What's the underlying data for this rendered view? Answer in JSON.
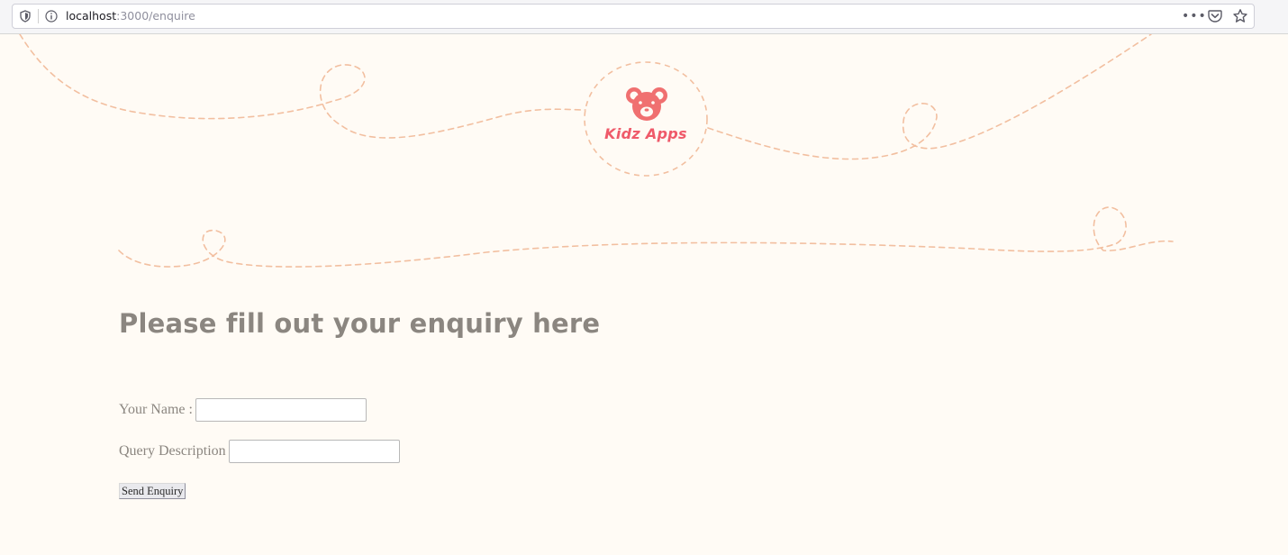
{
  "browser": {
    "url_host": "localhost",
    "url_path": ":3000/enquire"
  },
  "logo": {
    "text": "Kidz Apps"
  },
  "page": {
    "heading": "Please fill out your enquiry here"
  },
  "form": {
    "name_label": "Your Name :",
    "name_value": "",
    "query_label": "Query Description",
    "query_value": "",
    "submit_label": "Send Enquiry"
  },
  "colors": {
    "background": "#fffbf5",
    "accent": "#ef5a6a",
    "dashed_line": "#f2bfa0",
    "text": "#8b8680"
  }
}
